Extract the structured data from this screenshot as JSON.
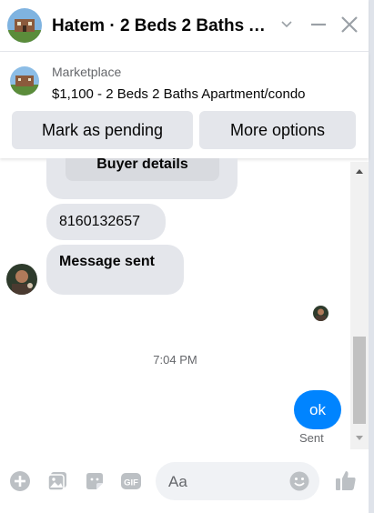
{
  "header": {
    "title": "Hatem · 2 Beds 2 Baths Ap...",
    "icons": [
      "chevron-down-icon",
      "minimize-icon",
      "close-icon"
    ]
  },
  "marketplace": {
    "label": "Marketplace",
    "listing": "$1,100 - 2 Beds 2 Baths Apartment/condo",
    "buttons": {
      "pending": "Mark as pending",
      "more": "More options"
    }
  },
  "messages": {
    "buyer_details_button": "Buyer details",
    "phone": "8160132657",
    "status_message": "Message sent",
    "timestamp": "7:04 PM",
    "outgoing": "ok",
    "outgoing_status": "Sent"
  },
  "composer": {
    "placeholder": "Aa",
    "icons": [
      "add-icon",
      "photo-icon",
      "sticker-icon",
      "gif-icon",
      "emoji-icon",
      "like-icon"
    ]
  },
  "colors": {
    "accent": "#0084ff",
    "bubble_gray": "#e4e6eb",
    "secondary_text": "#65676b"
  }
}
